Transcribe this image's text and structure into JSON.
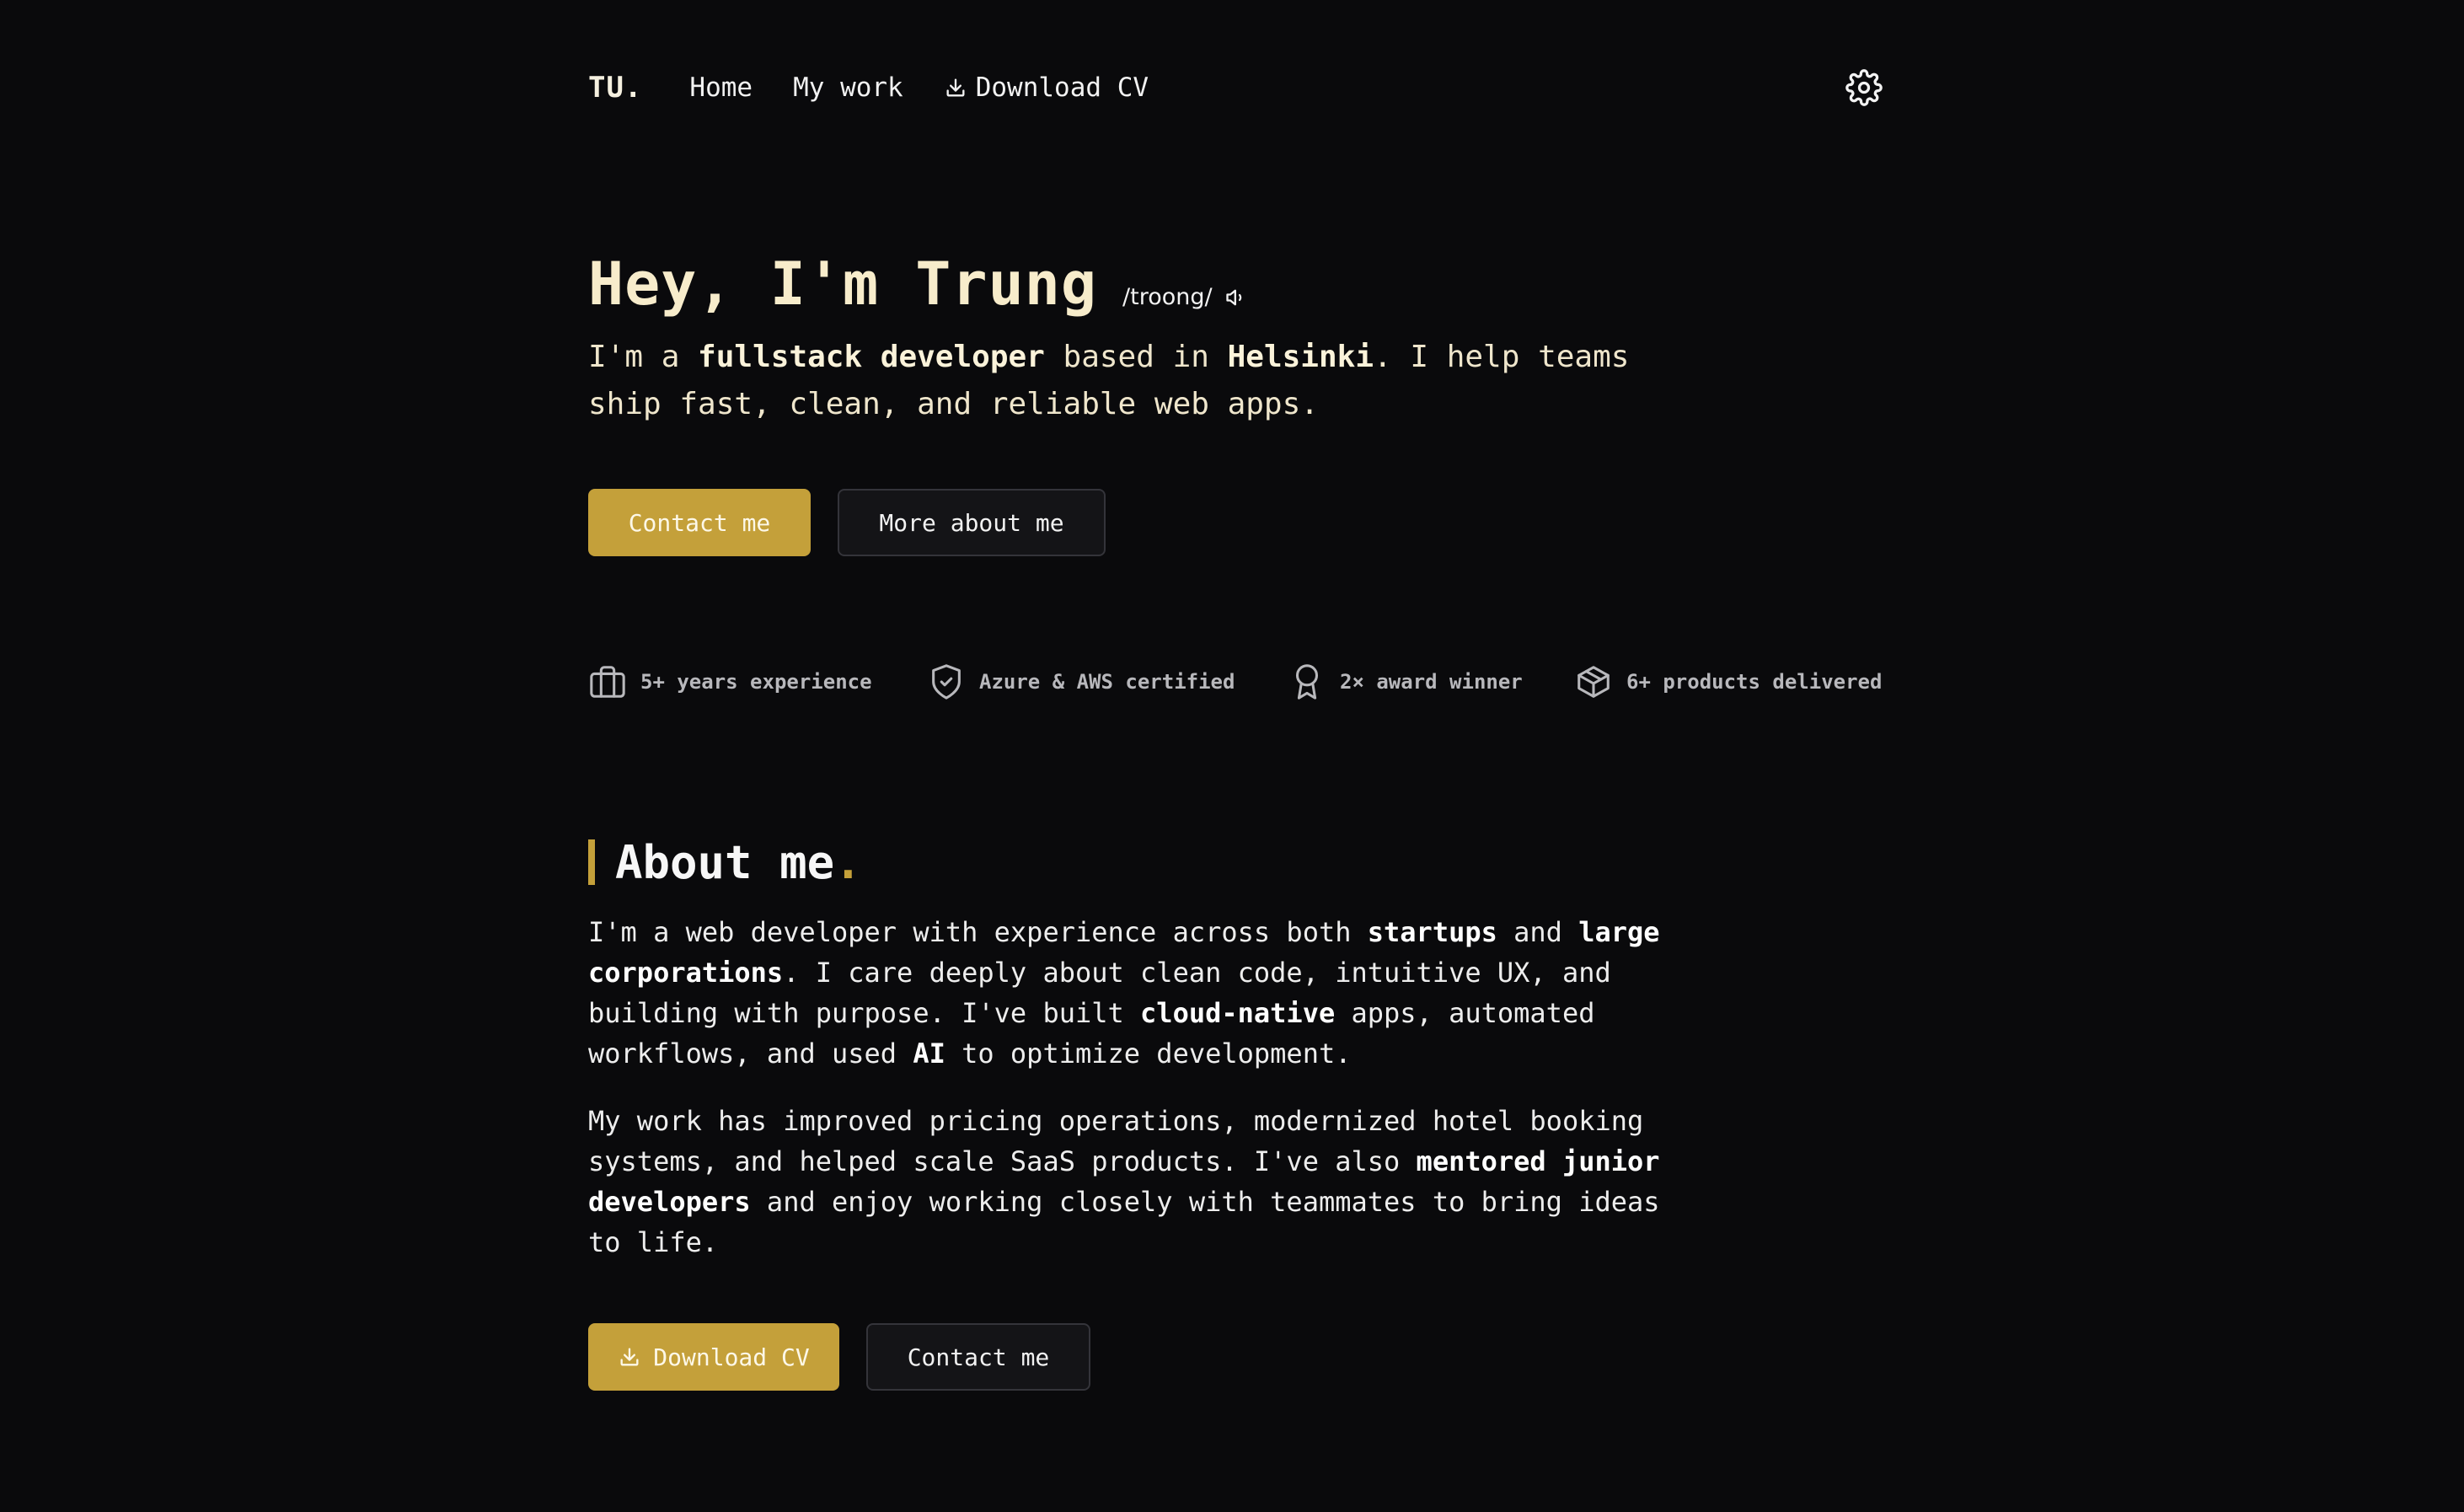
{
  "nav": {
    "logo": "TU.",
    "links": [
      "Home",
      "My work",
      "Download CV"
    ],
    "settings_icon": "gear-icon"
  },
  "hero": {
    "title": "Hey, I'm Trung",
    "pronunciation": "/troong/",
    "subtitle_parts": [
      "I'm a ",
      "fullstack developer",
      " based in ",
      "Helsinki",
      ". I help teams ship fast, clean, and reliable web apps."
    ],
    "primary_button": "Contact me",
    "secondary_button": "More about me"
  },
  "stats": [
    {
      "icon": "briefcase-icon",
      "label": "5+ years experience"
    },
    {
      "icon": "shield-check-icon",
      "label": "Azure & AWS certified"
    },
    {
      "icon": "award-icon",
      "label": "2× award winner"
    },
    {
      "icon": "package-icon",
      "label": "6+ products delivered"
    }
  ],
  "about": {
    "title": "About me",
    "title_dot": ".",
    "para1_parts": [
      "I'm a web developer with experience across both ",
      "startups",
      " and ",
      "large corporations",
      ". I care deeply about clean code, intuitive UX, and building with purpose. I've built ",
      "cloud-native",
      " apps, automated workflows, and used ",
      "AI",
      " to optimize development."
    ],
    "para2_parts": [
      "My work has improved pricing operations, modernized hotel booking systems, and helped scale SaaS products. I've also ",
      "mentored junior developers",
      " and enjoy working closely with teammates to bring ideas to life."
    ],
    "primary_button": "Download CV",
    "secondary_button": "Contact me"
  },
  "colors": {
    "background": "#0a0a0c",
    "accent": "#c4a03a",
    "heading": "#f7eccb"
  }
}
